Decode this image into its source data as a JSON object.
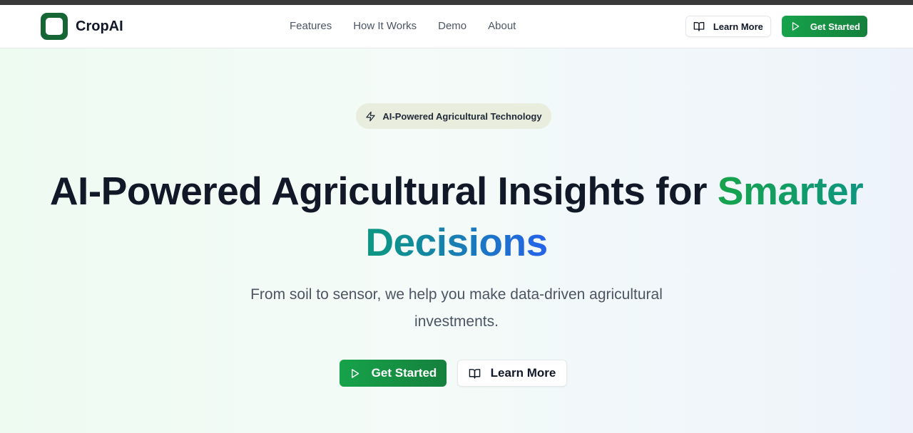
{
  "brand": {
    "name": "CropAI"
  },
  "nav": {
    "links": [
      "Features",
      "How It Works",
      "Demo",
      "About"
    ],
    "learn_more": "Learn More",
    "get_started": "Get Started"
  },
  "hero": {
    "badge": "AI-Powered Agricultural Technology",
    "title_main": "AI-Powered Agricultural Insights for ",
    "title_accent": "Smarter Decisions",
    "subtitle": "From soil to sensor, we help you make data-driven agricultural investments.",
    "cta_primary": "Get Started",
    "cta_secondary": "Learn More"
  },
  "icons": {
    "logo": "logo-icon",
    "book": "book-open-icon",
    "play": "play-icon",
    "zap": "zap-icon"
  },
  "colors": {
    "brand_green": "#16a34a",
    "dark_green": "#166534",
    "accent_teal": "#0d9488",
    "accent_blue": "#2563eb",
    "badge_bg": "#e8eddd"
  }
}
